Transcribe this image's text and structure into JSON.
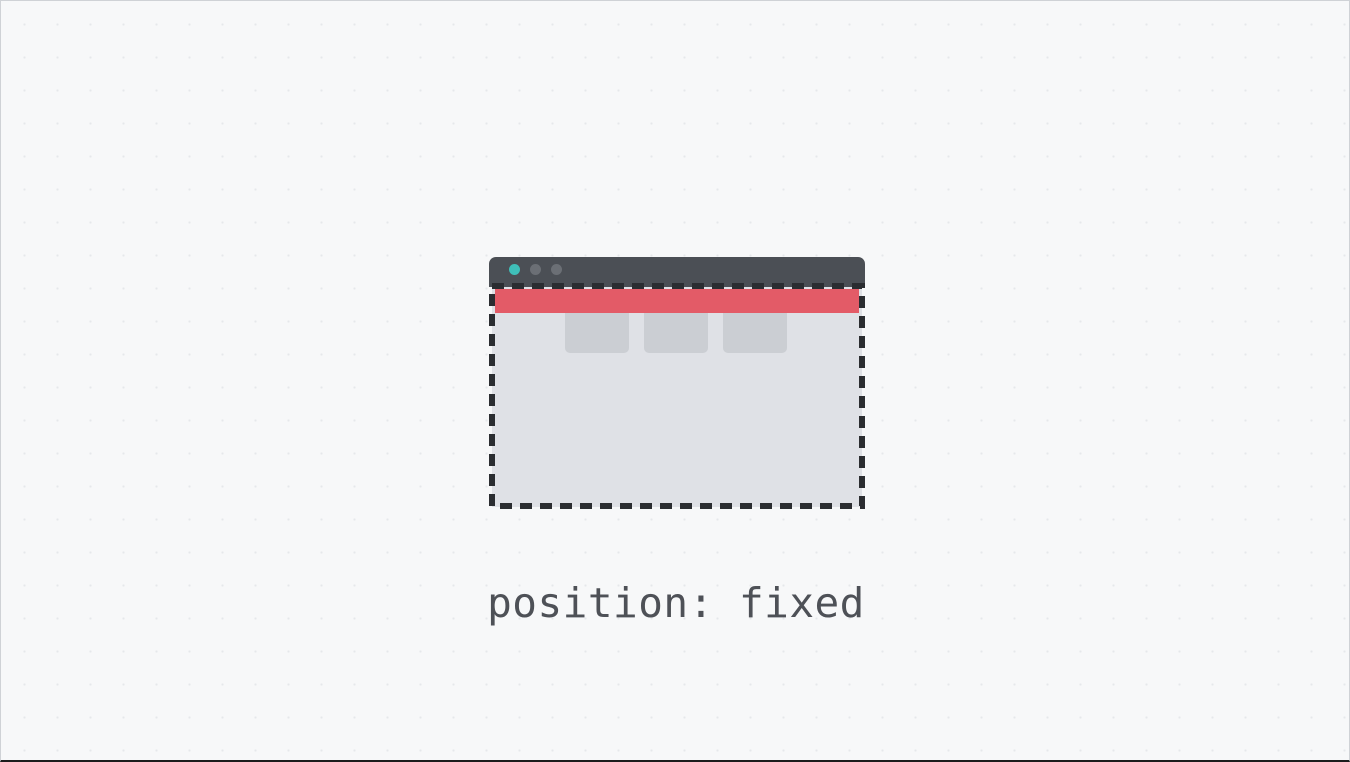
{
  "caption": "position: fixed",
  "colors": {
    "background": "#f7f8f9",
    "titlebar": "#4b4f55",
    "window_dot_active": "#3fbfb9",
    "window_dot_inactive": "#6b6f75",
    "fixed_bar": "#e35b67",
    "viewport": "#dfe1e6",
    "content_card": "#cbced3",
    "dashed_outline": "#2b2d31",
    "caption_text": "#4e5157"
  },
  "icons": {
    "window_dots": [
      "close-dot-icon",
      "minimize-dot-icon",
      "maximize-dot-icon"
    ]
  }
}
